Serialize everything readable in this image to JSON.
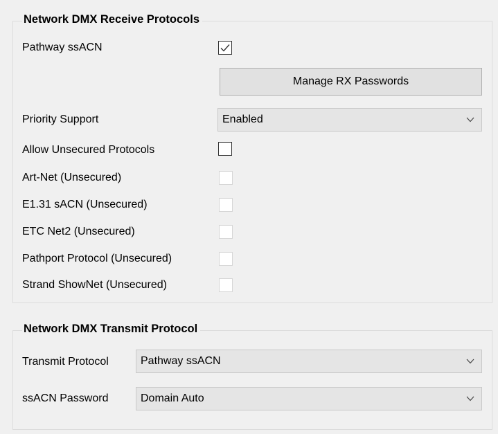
{
  "receive": {
    "title": "Network DMX Receive Protocols",
    "pathway_ssacn": {
      "label": "Pathway ssACN",
      "checked": true
    },
    "manage_button": "Manage RX Passwords",
    "priority": {
      "label": "Priority Support",
      "value": "Enabled"
    },
    "allow_unsecured": {
      "label": "Allow Unsecured Protocols",
      "checked": false
    },
    "protocols": [
      {
        "label": "Art-Net (Unsecured)",
        "checked": false,
        "enabled": false
      },
      {
        "label": "E1.31 sACN (Unsecured)",
        "checked": false,
        "enabled": false
      },
      {
        "label": "ETC Net2 (Unsecured)",
        "checked": false,
        "enabled": false
      },
      {
        "label": "Pathport Protocol (Unsecured)",
        "checked": false,
        "enabled": false
      },
      {
        "label": "Strand ShowNet (Unsecured)",
        "checked": false,
        "enabled": false
      }
    ]
  },
  "transmit": {
    "title": "Network DMX Transmit Protocol",
    "protocol": {
      "label": "Transmit Protocol",
      "value": "Pathway ssACN"
    },
    "password": {
      "label": "ssACN Password",
      "value": "Domain Auto"
    }
  },
  "icons": {
    "check": "checkmark-icon",
    "dropdown": "chevron-down-icon"
  }
}
